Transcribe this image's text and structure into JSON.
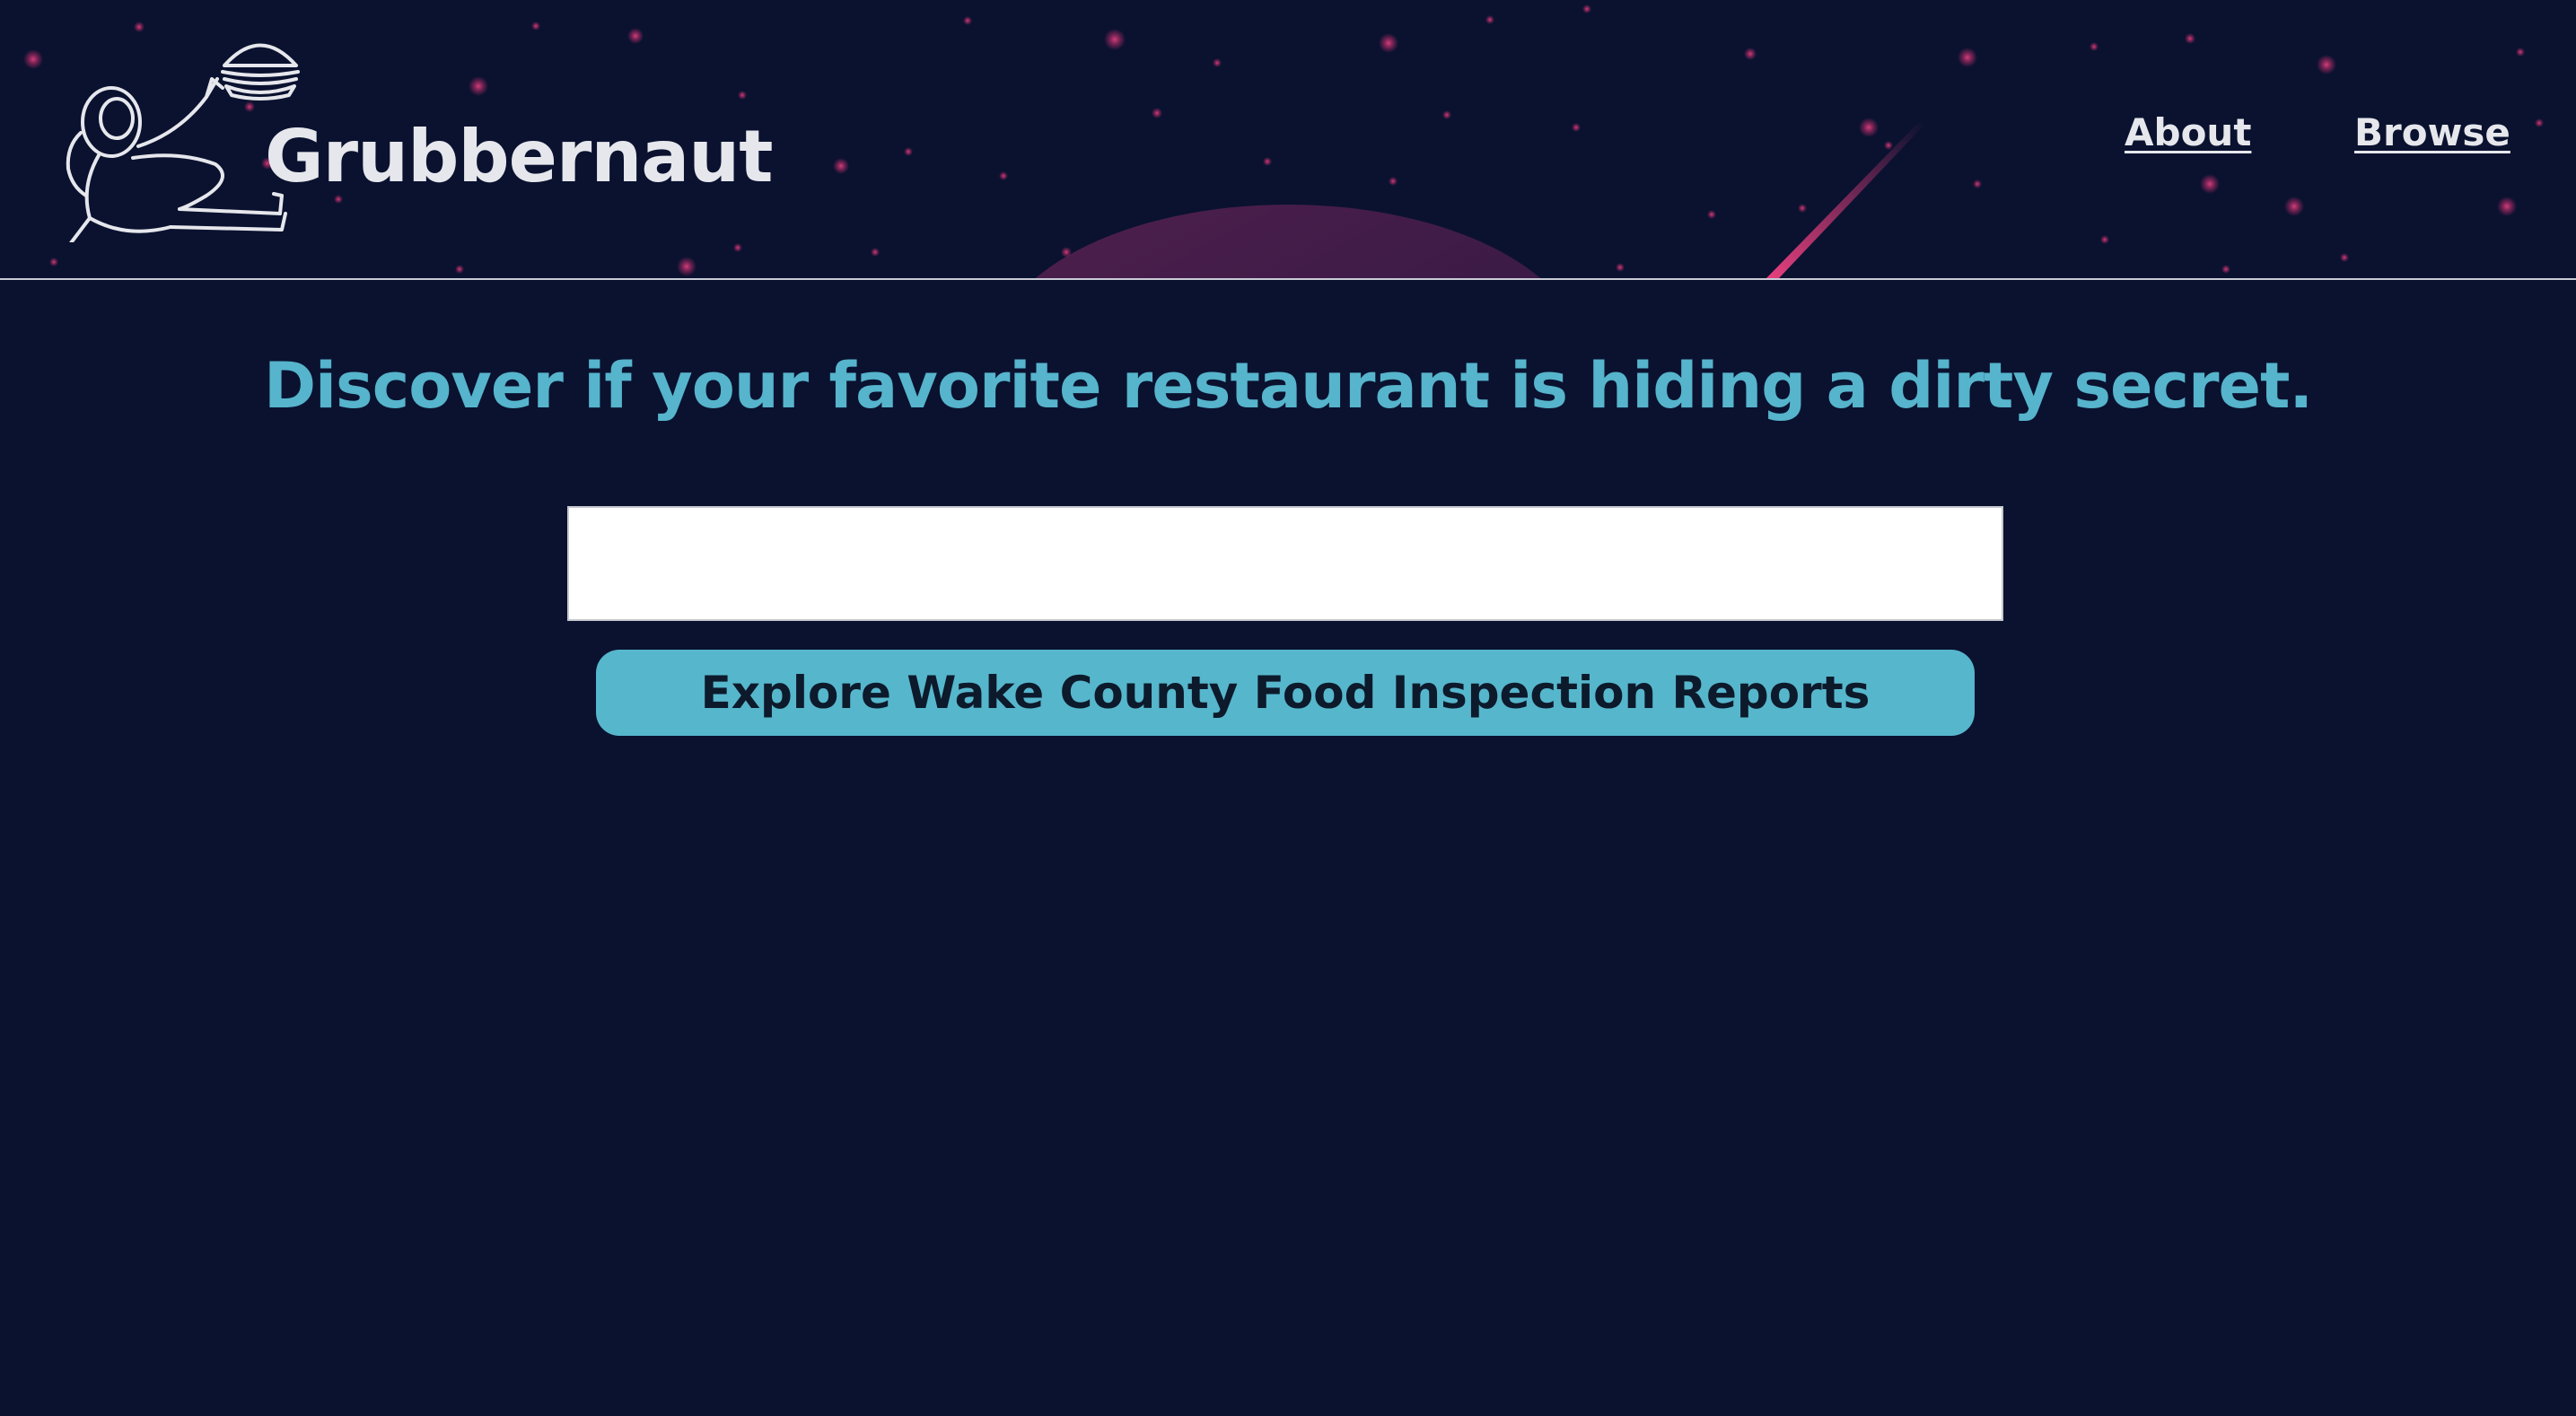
{
  "header": {
    "brand_name": "Grubbernaut",
    "logo_icon": "astronaut-burger-logo-icon",
    "nav": [
      {
        "label": "About"
      },
      {
        "label": "Browse"
      }
    ]
  },
  "main": {
    "headline": "Discover if your favorite restaurant is hiding a dirty secret.",
    "search": {
      "value": "",
      "placeholder": ""
    },
    "explore_button_label": "Explore Wake County Food Inspection Reports"
  },
  "colors": {
    "background": "#0a1230",
    "accent": "#56b6cc",
    "star_pink": "#d6306f",
    "text_light": "#e6e7ec"
  }
}
